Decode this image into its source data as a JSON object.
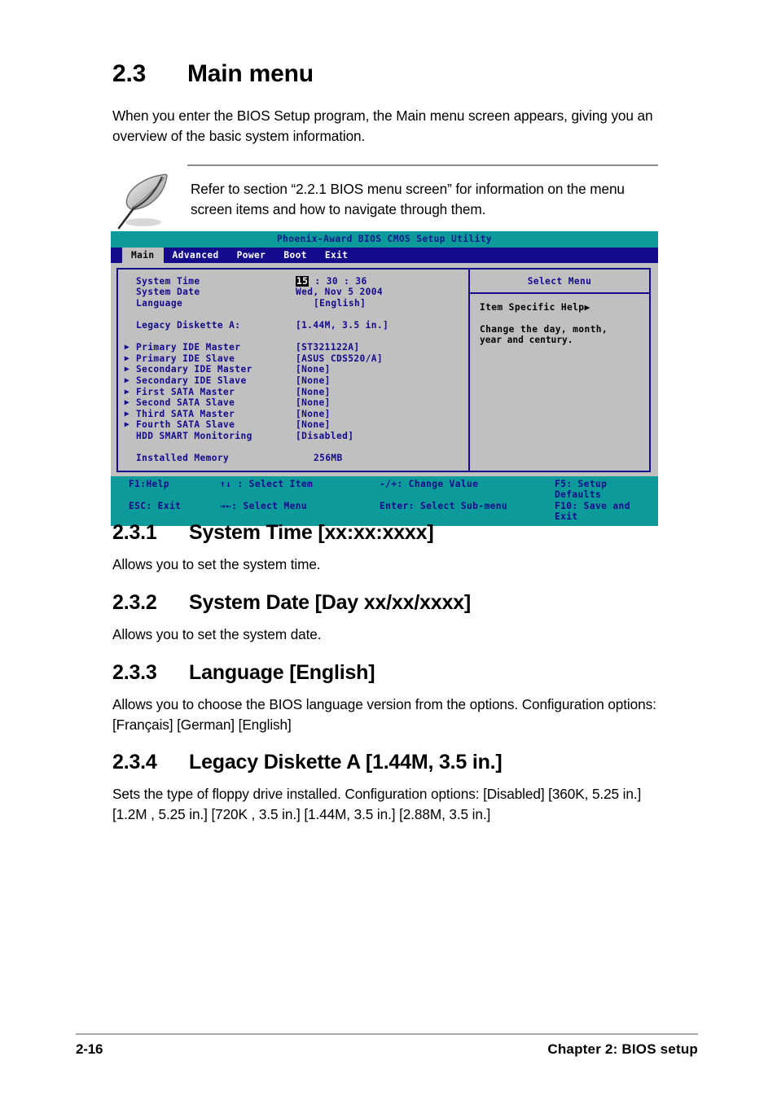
{
  "section": {
    "number": "2.3",
    "title": "Main menu",
    "intro": "When you enter the BIOS Setup program, the Main menu screen appears, giving you an overview of the basic system information."
  },
  "note": {
    "icon": "feather-pen-icon",
    "text": "Refer to section “2.2.1  BIOS menu screen” for information on the menu screen items and how to navigate through them."
  },
  "bios": {
    "title": "Phoenix-Award BIOS CMOS Setup Utility",
    "tabs": [
      {
        "label": "Main",
        "active": true
      },
      {
        "label": "Advanced",
        "active": false
      },
      {
        "label": "Power",
        "active": false
      },
      {
        "label": "Boot",
        "active": false
      },
      {
        "label": "Exit",
        "active": false
      }
    ],
    "rows": [
      {
        "mark": "",
        "label": "System Time",
        "value_pre": "",
        "value_hl": "15",
        "value_post": " : 30 : 36"
      },
      {
        "mark": "",
        "label": "System Date",
        "value": "Wed, Nov 5 2004"
      },
      {
        "mark": "",
        "label": "Language",
        "value": "[English]",
        "indent": true
      },
      {
        "spacer": true
      },
      {
        "mark": "",
        "label": "Legacy Diskette A:",
        "value": "[1.44M, 3.5 in.]"
      },
      {
        "spacer": true
      },
      {
        "mark": "▶",
        "label": "Primary IDE Master",
        "value": "[ST321122A]"
      },
      {
        "mark": "▶",
        "label": "Primary IDE Slave",
        "value": "[ASUS CDS520/A]"
      },
      {
        "mark": "▶",
        "label": "Secondary IDE Master",
        "value": "[None]"
      },
      {
        "mark": "▶",
        "label": "Secondary IDE Slave",
        "value": "[None]"
      },
      {
        "mark": "▶",
        "label": "First SATA Master",
        "value": "[None]"
      },
      {
        "mark": "▶",
        "label": "Second SATA Slave",
        "value": "[None]"
      },
      {
        "mark": "▶",
        "label": "Third SATA Master",
        "value": "[None]"
      },
      {
        "mark": "▶",
        "label": "Fourth SATA Slave",
        "value": "[None]"
      },
      {
        "mark": "",
        "label": "HDD SMART Monitoring",
        "value": "[Disabled]"
      },
      {
        "spacer": true
      },
      {
        "mark": "",
        "label": "Installed Memory",
        "value": "256MB",
        "indent": true
      }
    ],
    "help": {
      "heading": "Select Menu",
      "subheading": "Item Specific Help▶",
      "text_line1": "Change the day, month,",
      "text_line2": "year and century."
    },
    "footer": {
      "row1": {
        "c1": "F1:Help",
        "c2": "↑↓ : Select Item",
        "c3": "-/+: Change Value",
        "c4": "F5: Setup Defaults"
      },
      "row2": {
        "c1": "ESC: Exit",
        "c2": "→←: Select Menu",
        "c3": "Enter: Select Sub-menu",
        "c4": "F10: Save and Exit"
      }
    },
    "colors": {
      "title_bar": "#0d9a9a",
      "tab_bar": "#140a8c",
      "panel": "#c0c0c0",
      "text": "#140a8c",
      "active_tab_bg": "#c0c0c0"
    }
  },
  "subsections": [
    {
      "number": "2.3.1",
      "title": "System Time [xx:xx:xxxx]",
      "body": "Allows you to set the system time."
    },
    {
      "number": "2.3.2",
      "title": "System Date [Day xx/xx/xxxx]",
      "body": "Allows you to set the system date."
    },
    {
      "number": "2.3.3",
      "title": "Language [English]",
      "body": "Allows you to choose the BIOS language version from the options. Configuration options: [Français] [German] [English]"
    },
    {
      "number": "2.3.4",
      "title": "Legacy Diskette A [1.44M, 3.5 in.]",
      "body": "Sets the type of floppy drive installed. Configuration options: [Disabled] [360K, 5.25 in.] [1.2M , 5.25 in.] [720K , 3.5 in.] [1.44M, 3.5 in.] [2.88M, 3.5  in.]"
    }
  ],
  "page_footer": {
    "page_number": "2-16",
    "chapter": "Chapter 2: BIOS setup"
  }
}
